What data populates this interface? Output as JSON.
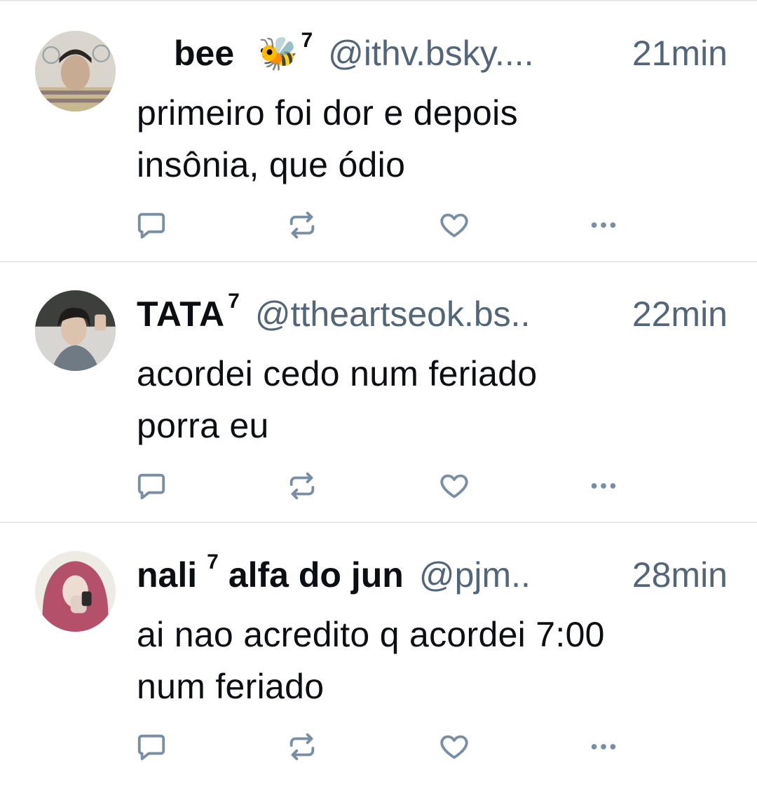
{
  "posts": [
    {
      "display_name": "bee",
      "emoji": "🐝",
      "name_suffix": "7",
      "handle": "@ithv.bsky....",
      "time": "21min",
      "text_line1": "primeiro foi dor e depois",
      "text_line2": "insônia, que ódio"
    },
    {
      "display_name": "TATA",
      "name_suffix": "7",
      "handle": "@ttheartseok.bs..",
      "time": "22min",
      "text_line1": "acordei cedo num feriado",
      "text_line2": "porra eu"
    },
    {
      "display_name": "nali",
      "name_suffix": "7",
      "name_rest": "alfa do jun",
      "handle": "@pjm..",
      "time": "28min",
      "text_line1": "ai nao acredito q acordei 7:00",
      "text_line2": "num feriado"
    }
  ],
  "icons": {
    "reply": "reply-icon",
    "repost": "repost-icon",
    "like": "heart-icon",
    "more": "more-options-icon"
  },
  "colors": {
    "text": "#0b0f14",
    "secondary": "#526579",
    "icon": "#788ea5",
    "divider": "#e6e9ec"
  }
}
